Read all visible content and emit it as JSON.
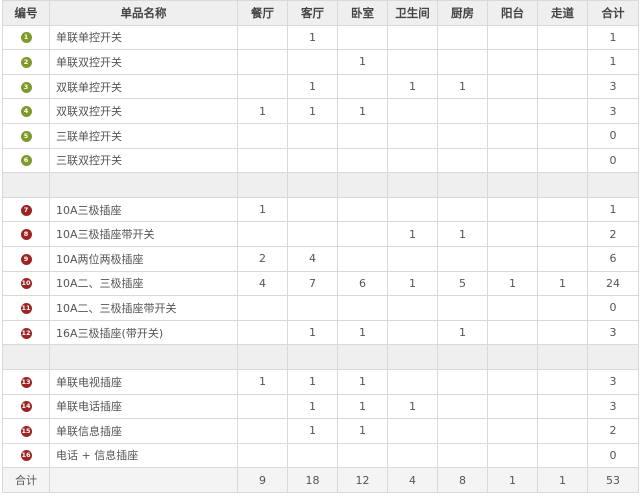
{
  "headers": {
    "num": "编号",
    "name": "单品名称",
    "rooms": [
      "餐厅",
      "客厅",
      "卧室",
      "卫生间",
      "厨房",
      "阳台",
      "走道"
    ],
    "total": "合计"
  },
  "badge_colors": {
    "green": "#7f9a2b",
    "red": "#9e2424"
  },
  "groups": [
    {
      "rows": [
        {
          "num": "1",
          "color": "green",
          "name": "单联单控开关",
          "cells": [
            "",
            "1",
            "",
            "",
            "",
            "",
            ""
          ],
          "total": "1"
        },
        {
          "num": "2",
          "color": "green",
          "name": "单联双控开关",
          "cells": [
            "",
            "",
            "1",
            "",
            "",
            "",
            ""
          ],
          "total": "1"
        },
        {
          "num": "3",
          "color": "green",
          "name": "双联单控开关",
          "cells": [
            "",
            "1",
            "",
            "1",
            "1",
            "",
            ""
          ],
          "total": "3"
        },
        {
          "num": "4",
          "color": "green",
          "name": "双联双控开关",
          "cells": [
            "1",
            "1",
            "1",
            "",
            "",
            "",
            ""
          ],
          "total": "3"
        },
        {
          "num": "5",
          "color": "green",
          "name": "三联单控开关",
          "cells": [
            "",
            "",
            "",
            "",
            "",
            "",
            ""
          ],
          "total": "0"
        },
        {
          "num": "6",
          "color": "green",
          "name": "三联双控开关",
          "cells": [
            "",
            "",
            "",
            "",
            "",
            "",
            ""
          ],
          "total": "0"
        }
      ]
    },
    {
      "rows": [
        {
          "num": "7",
          "color": "red",
          "name": "10A三极插座",
          "cells": [
            "1",
            "",
            "",
            "",
            "",
            "",
            ""
          ],
          "total": "1"
        },
        {
          "num": "8",
          "color": "red",
          "name": "10A三极插座带开关",
          "cells": [
            "",
            "",
            "",
            "1",
            "1",
            "",
            ""
          ],
          "total": "2"
        },
        {
          "num": "9",
          "color": "red",
          "name": "10A两位两极插座",
          "cells": [
            "2",
            "4",
            "",
            "",
            "",
            "",
            ""
          ],
          "total": "6"
        },
        {
          "num": "10",
          "color": "red",
          "name": "10A二、三极插座",
          "cells": [
            "4",
            "7",
            "6",
            "1",
            "5",
            "1",
            "1"
          ],
          "total": "24"
        },
        {
          "num": "11",
          "color": "red",
          "name": "10A二、三极插座带开关",
          "cells": [
            "",
            "",
            "",
            "",
            "",
            "",
            ""
          ],
          "total": "0"
        },
        {
          "num": "12",
          "color": "red",
          "name": "16A三极插座(带开关)",
          "cells": [
            "",
            "1",
            "1",
            "",
            "1",
            "",
            ""
          ],
          "total": "3"
        }
      ]
    },
    {
      "rows": [
        {
          "num": "13",
          "color": "red",
          "name": "单联电视插座",
          "cells": [
            "1",
            "1",
            "1",
            "",
            "",
            "",
            ""
          ],
          "total": "3"
        },
        {
          "num": "14",
          "color": "red",
          "name": "单联电话插座",
          "cells": [
            "",
            "1",
            "1",
            "1",
            "",
            "",
            ""
          ],
          "total": "3"
        },
        {
          "num": "15",
          "color": "red",
          "name": "单联信息插座",
          "cells": [
            "",
            "1",
            "1",
            "",
            "",
            "",
            ""
          ],
          "total": "2"
        },
        {
          "num": "16",
          "color": "red",
          "name": "电话 + 信息插座",
          "cells": [
            "",
            "",
            "",
            "",
            "",
            "",
            ""
          ],
          "total": "0"
        }
      ]
    }
  ],
  "footer": {
    "label": "合计",
    "cells": [
      "9",
      "18",
      "12",
      "4",
      "8",
      "1",
      "1"
    ],
    "total": "53"
  }
}
